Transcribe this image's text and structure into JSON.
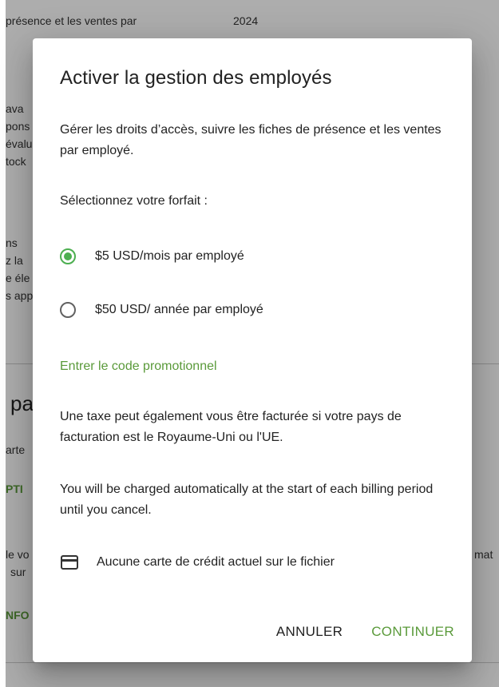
{
  "background": {
    "top_text": "présence et les ventes par",
    "top_year": "2024",
    "frag1": [
      "ava",
      "pons",
      "évalu",
      "tock"
    ],
    "frag2": [
      "ns",
      "z la",
      "e éle",
      "s app"
    ],
    "heading_frag": "pa",
    "frag3": "arte",
    "green1": "PTI",
    "frag4": [
      "le vo",
      "sur"
    ],
    "right_frag": "mat",
    "green2": "NFO"
  },
  "dialog": {
    "title": "Activer la gestion des employés",
    "description": "Gérer les droits d’accès, suivre les fiches de présence et les ventes par employé.",
    "plan_prompt": "Sélectionnez votre forfait :",
    "plans": [
      {
        "label": "$5 USD/mois par employé",
        "selected": true
      },
      {
        "label": "$50 USD/ année par employé",
        "selected": false
      }
    ],
    "promo_link": "Entrer le code promotionnel",
    "tax_note": "Une taxe peut également vous être facturée si votre pays de facturation est le Royaume-Uni ou l'UE.",
    "charge_note": "You will be charged automatically at the start of each billing period until you cancel.",
    "card_icon": "credit-card-icon",
    "card_status": "Aucune carte de crédit actuel sur le fichier",
    "cancel_label": "ANNULER",
    "continue_label": "CONTINUER"
  },
  "colors": {
    "accent": "#4caf50",
    "link": "#5a9a3a",
    "scrim": "rgba(0,0,0,0.32)"
  }
}
